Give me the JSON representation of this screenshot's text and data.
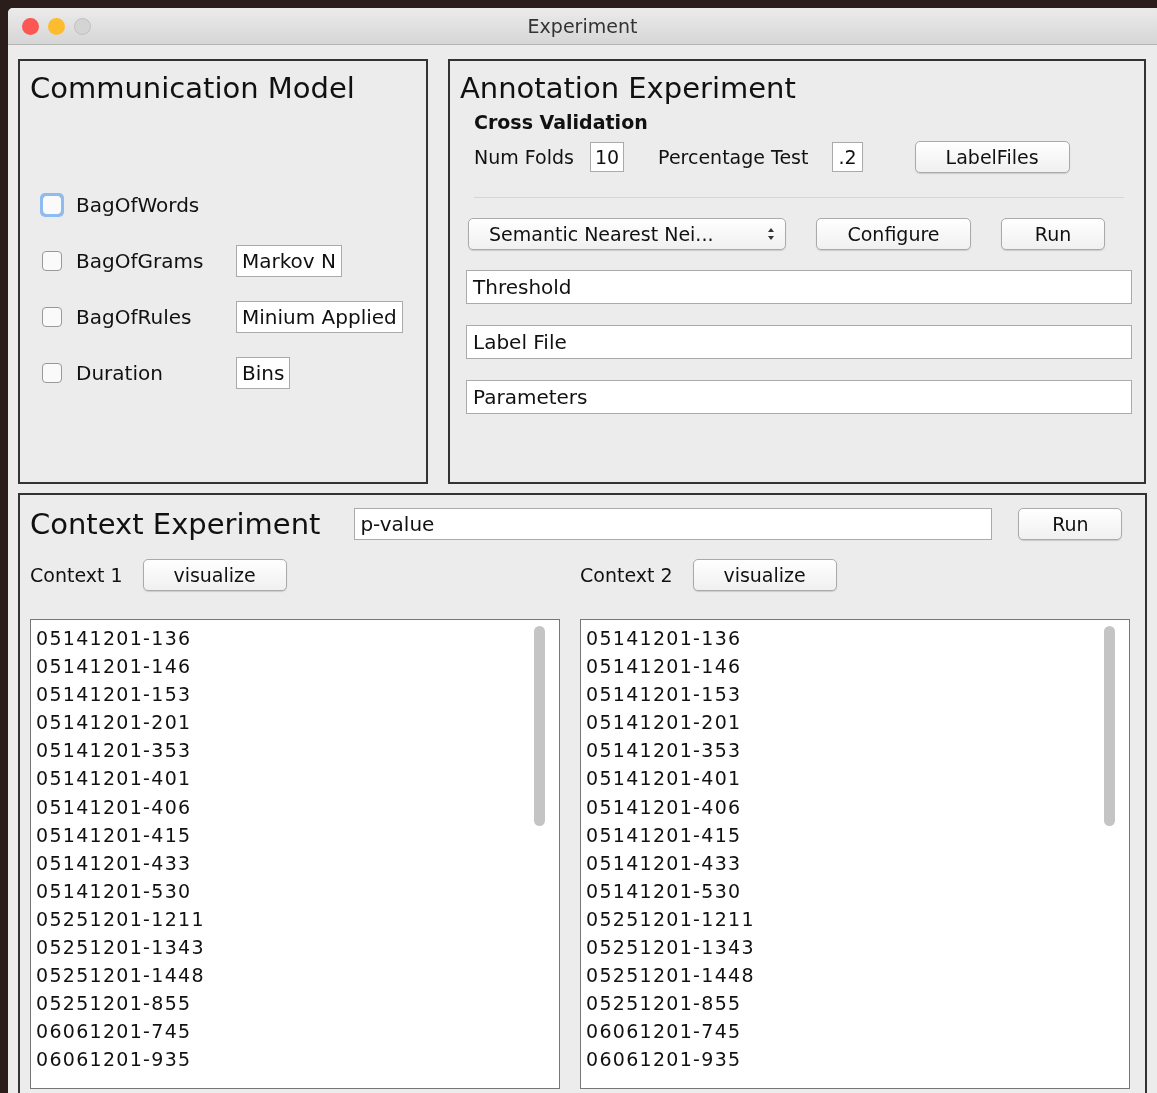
{
  "window": {
    "title": "Experiment"
  },
  "communication_model": {
    "title": "Communication Model",
    "options": [
      {
        "label": "BagOfWords",
        "checked": false,
        "focused": true
      },
      {
        "label": "BagOfGrams",
        "checked": false,
        "focused": false,
        "field": "Markov N"
      },
      {
        "label": "BagOfRules",
        "checked": false,
        "focused": false,
        "field": "Minium Applied"
      },
      {
        "label": "Duration",
        "checked": false,
        "focused": false,
        "field": "Bins"
      }
    ]
  },
  "annotation_experiment": {
    "title": "Annotation Experiment",
    "subtitle": "Cross Validation",
    "num_folds": {
      "label": "Num Folds",
      "value": "10"
    },
    "percentage_test": {
      "label": "Percentage Test",
      "value": ".2"
    },
    "label_files_button": "LabelFiles",
    "method_select": "Semantic Nearest Nei...",
    "configure_button": "Configure",
    "run_button": "Run",
    "fields": [
      "Threshold",
      "Label File",
      "Parameters"
    ]
  },
  "context_experiment": {
    "title": "Context Experiment",
    "p_value": "p-value",
    "run_button": "Run",
    "contexts": [
      {
        "label": "Context 1",
        "button": "visualize",
        "items": [
          "05141201-136",
          "05141201-146",
          "05141201-153",
          "05141201-201",
          "05141201-353",
          "05141201-401",
          "05141201-406",
          "05141201-415",
          "05141201-433",
          "05141201-530",
          "05251201-1211",
          "05251201-1343",
          "05251201-1448",
          "05251201-855",
          "06061201-745",
          "06061201-935"
        ]
      },
      {
        "label": "Context 2",
        "button": "visualize",
        "items": [
          "05141201-136",
          "05141201-146",
          "05141201-153",
          "05141201-201",
          "05141201-353",
          "05141201-401",
          "05141201-406",
          "05141201-415",
          "05141201-433",
          "05141201-530",
          "05251201-1211",
          "05251201-1343",
          "05251201-1448",
          "05251201-855",
          "06061201-745",
          "06061201-935"
        ]
      }
    ]
  }
}
